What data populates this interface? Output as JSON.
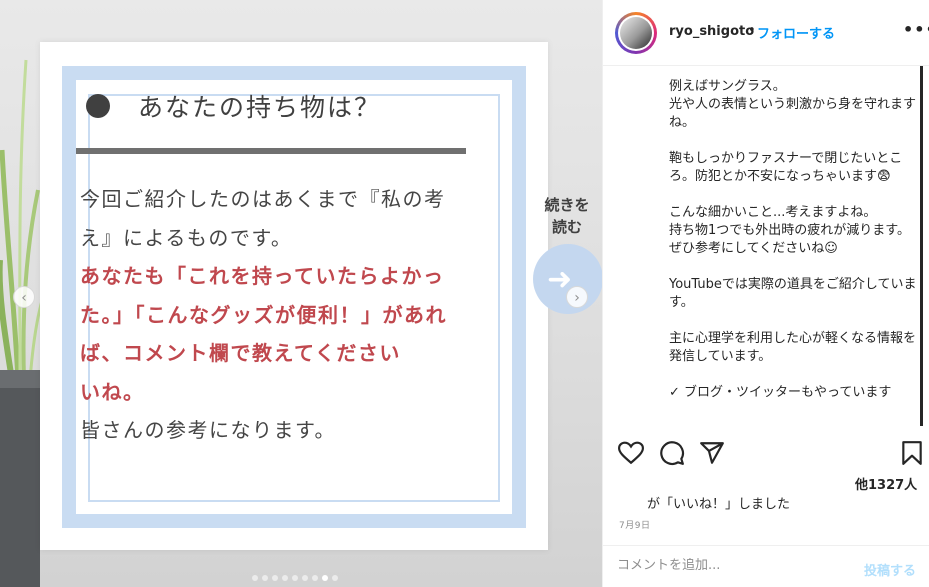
{
  "post_image": {
    "title": "あなたの持ち物は？",
    "body_intro": "今回ご紹介したのはあくまで『私の考え』によるものです。",
    "body_highlight": "あなたも「これを持っていたらよかった。」「こんなグッズが便利！」があれば、コメント欄で教えてください",
    "body_highlight_end": "いね。",
    "body_outro": "皆さんの参考になります。",
    "continue_label": "続きを\n読む",
    "accent_color": "#c0484e",
    "frame_color": "#c9dcf2"
  },
  "carousel": {
    "prev_icon": "chevron-left-icon",
    "next_icon": "chevron-right-icon",
    "dot_count": 9,
    "active_dot": 7
  },
  "header": {
    "username": "ryo_shigoto",
    "separator": "•",
    "follow_label": "フォローする",
    "more_icon": "•••"
  },
  "caption": {
    "text": "例えばサングラス。\n光や人の表情という刺激から身を守れますね。\n\n鞄もしっかりファスナーで閉じたいところ。防犯とか不安になっちゃいます😨\n\nこんな細かいこと...考えますよね。\n持ち物1つでも外出時の疲れが減ります。\nぜひ参考にしてくださいね☺\n\nYouTubeでは実際の道具をご紹介しています。\n\n主に心理学を利用した心が軽くなる情報を発信しています。\n\n✓ ブログ・ツイッターもやっています"
  },
  "actions": {
    "like_icon": "heart-icon",
    "comment_icon": "comment-icon",
    "share_icon": "share-icon",
    "save_icon": "bookmark-icon"
  },
  "likes": {
    "count_label": "他1327人",
    "liked_by_text": "が「いいね！」しました"
  },
  "date_label": "7月9日",
  "comment": {
    "placeholder": "コメントを追加...",
    "post_label": "投稿する"
  }
}
